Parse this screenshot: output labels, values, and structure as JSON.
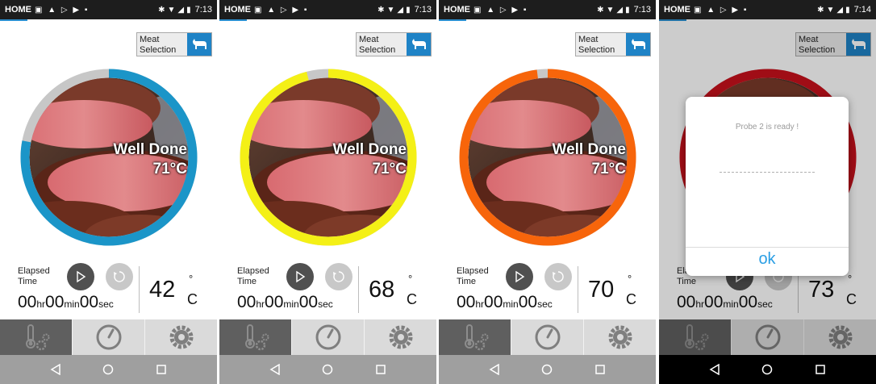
{
  "phones": [
    {
      "status": {
        "home": "HOME",
        "time": "7:13"
      },
      "meat_selection_label": "Meat Selection",
      "doneness": "Well Done",
      "target_temp": "71°C",
      "ring_progress_fraction": 0.78,
      "ring_color": "#1b95c8",
      "elapsed_label": "Elapsed Time",
      "timer": {
        "hr": "00",
        "hr_unit": "hr",
        "min": "00",
        "min_unit": "min",
        "sec": "00",
        "sec_unit": "sec"
      },
      "current_temp": "42",
      "degree_symbol": "°",
      "temp_unit": "C"
    },
    {
      "status": {
        "home": "HOME",
        "time": "7:13"
      },
      "meat_selection_label": "Meat Selection",
      "doneness": "Well Done",
      "target_temp": "71°C",
      "ring_progress_fraction": 0.96,
      "ring_color": "#f4f016",
      "elapsed_label": "Elapsed Time",
      "timer": {
        "hr": "00",
        "hr_unit": "hr",
        "min": "00",
        "min_unit": "min",
        "sec": "00",
        "sec_unit": "sec"
      },
      "current_temp": "68",
      "degree_symbol": "°",
      "temp_unit": "C"
    },
    {
      "status": {
        "home": "HOME",
        "time": "7:13"
      },
      "meat_selection_label": "Meat Selection",
      "doneness": "Well Done",
      "target_temp": "71°C",
      "ring_progress_fraction": 0.98,
      "ring_color": "#f7650b",
      "elapsed_label": "Elapsed Time",
      "timer": {
        "hr": "00",
        "hr_unit": "hr",
        "min": "00",
        "min_unit": "min",
        "sec": "00",
        "sec_unit": "sec"
      },
      "current_temp": "70",
      "degree_symbol": "°",
      "temp_unit": "C"
    },
    {
      "status": {
        "home": "HOME",
        "time": "7:14"
      },
      "meat_selection_label": "Meat Selection",
      "ring_progress_fraction": 1.0,
      "ring_color": "#c8111c",
      "elapsed_label": "Elapsed Time",
      "timer": {
        "hr": "00",
        "hr_unit": "hr",
        "min": "00",
        "min_unit": "min",
        "sec": "00",
        "sec_unit": "sec"
      },
      "current_temp": "73",
      "degree_symbol": "°",
      "temp_unit": "C",
      "dialog": {
        "message": "Probe 2  is ready !",
        "ok_label": "ok"
      }
    }
  ],
  "tabs": [
    {
      "icon": "thermometer-gear-icon"
    },
    {
      "icon": "timer-icon"
    },
    {
      "icon": "settings-gear-icon"
    }
  ],
  "nav": [
    {
      "icon": "back-triangle-icon"
    },
    {
      "icon": "home-circle-icon"
    },
    {
      "icon": "recents-square-icon"
    }
  ],
  "colors": {
    "accent_blue": "#1f83c6",
    "ring_background": "#c7c7c7",
    "dialog_ok": "#2a9ee4"
  }
}
